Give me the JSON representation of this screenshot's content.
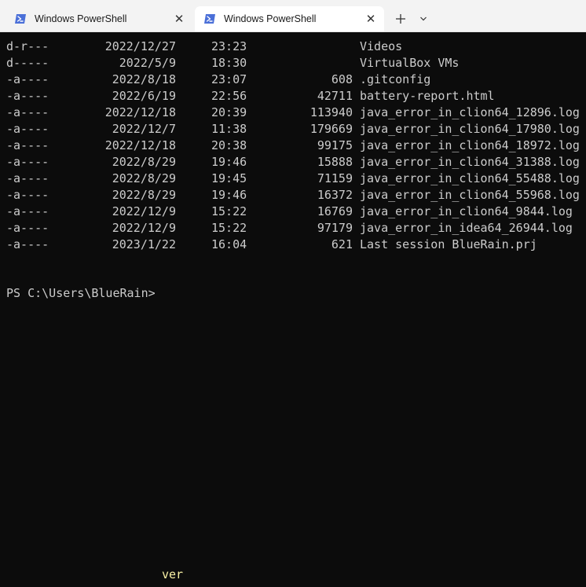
{
  "tabs": [
    {
      "label": "Windows PowerShell",
      "active": false
    },
    {
      "label": "Windows PowerShell",
      "active": true
    }
  ],
  "tab_close_glyph": "✕",
  "new_tab_glyph": "+",
  "dropdown_glyph": "⌄",
  "colors": {
    "terminal_bg": "#0c0c0c",
    "terminal_fg": "#cccccc",
    "tabbar_bg": "#f3f3f3",
    "active_tab_bg": "#ffffff",
    "ps_icon": "#4a6fd8",
    "suggestion": "#f9f1a5"
  },
  "listing": [
    {
      "mode": "d-r---",
      "date": "2022/12/27",
      "time": "23:23",
      "length": "",
      "name": "Videos"
    },
    {
      "mode": "d-----",
      "date": "2022/5/9",
      "time": "18:30",
      "length": "",
      "name": "VirtualBox VMs"
    },
    {
      "mode": "-a----",
      "date": "2022/8/18",
      "time": "23:07",
      "length": "608",
      "name": ".gitconfig"
    },
    {
      "mode": "-a----",
      "date": "2022/6/19",
      "time": "22:56",
      "length": "42711",
      "name": "battery-report.html"
    },
    {
      "mode": "-a----",
      "date": "2022/12/18",
      "time": "20:39",
      "length": "113940",
      "name": "java_error_in_clion64_12896.log"
    },
    {
      "mode": "-a----",
      "date": "2022/12/7",
      "time": "11:38",
      "length": "179669",
      "name": "java_error_in_clion64_17980.log"
    },
    {
      "mode": "-a----",
      "date": "2022/12/18",
      "time": "20:38",
      "length": "99175",
      "name": "java_error_in_clion64_18972.log"
    },
    {
      "mode": "-a----",
      "date": "2022/8/29",
      "time": "19:46",
      "length": "15888",
      "name": "java_error_in_clion64_31388.log"
    },
    {
      "mode": "-a----",
      "date": "2022/8/29",
      "time": "19:45",
      "length": "71159",
      "name": "java_error_in_clion64_55488.log"
    },
    {
      "mode": "-a----",
      "date": "2022/8/29",
      "time": "19:46",
      "length": "16372",
      "name": "java_error_in_clion64_55968.log"
    },
    {
      "mode": "-a----",
      "date": "2022/12/9",
      "time": "15:22",
      "length": "16769",
      "name": "java_error_in_clion64_9844.log"
    },
    {
      "mode": "-a----",
      "date": "2022/12/9",
      "time": "15:22",
      "length": "97179",
      "name": "java_error_in_idea64_26944.log"
    },
    {
      "mode": "-a----",
      "date": "2023/1/22",
      "time": "16:04",
      "length": "621",
      "name": "Last session BlueRain.prj"
    }
  ],
  "prompt": "PS C:\\Users\\BlueRain>",
  "suggestion": "ver"
}
